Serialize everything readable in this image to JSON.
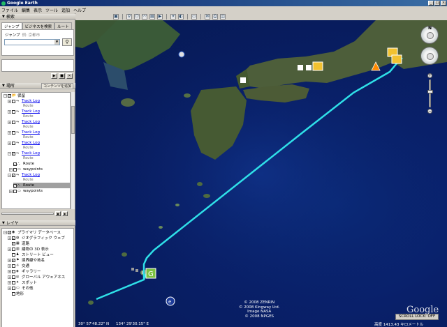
{
  "window": {
    "title": "Google Earth"
  },
  "menu": [
    "ファイル",
    "編集",
    "表示",
    "ツール",
    "追加",
    "ヘルプ"
  ],
  "search": {
    "panel_title": "検索",
    "tabs": [
      "ジャンプ",
      "ビジネスを検索",
      "ルート"
    ],
    "label": "ジャンプ",
    "placeholder": "例: 京都市",
    "value": ""
  },
  "places": {
    "panel_title": "場所",
    "add_label": "コンテンツを追加",
    "root_label": "保留",
    "items": [
      {
        "label": "Track Log",
        "sub": "Route"
      },
      {
        "label": "Track Log",
        "sub": "Route"
      },
      {
        "label": "Track Log",
        "sub": "Route"
      },
      {
        "label": "Track Log",
        "sub": "Route"
      },
      {
        "label": "Track Log",
        "sub": "Route"
      },
      {
        "label": "Track Log",
        "sub": "Route"
      }
    ],
    "expanded": [
      {
        "child": "Route",
        "waypoints": "waypoints"
      },
      {
        "parent": "Track Log",
        "sub": "Route",
        "child": "Route",
        "waypoints": "waypoints"
      }
    ]
  },
  "layers": {
    "panel_title": "レイヤ",
    "root_label": "プライマリ データベース",
    "items": [
      "ジオグラフィック ウェブ",
      "道路",
      "建物の 3D 表示",
      "ストリート ビュー",
      "境界線や地名",
      "交通",
      "ギャラリー",
      "グローバル アウェアネス",
      "スポット",
      "その他",
      "地形"
    ]
  },
  "map": {
    "credits": [
      "© 2008 ZENRIN",
      "© 2008 Kingway Ltd.",
      "Image NASA",
      "© 2008 NPGES"
    ],
    "status": {
      "lat": "30° 57'48.22\" N",
      "lon": "134° 29'30.15\" E",
      "alt": "高度 1413.43 キロメートル"
    },
    "logo": "Google",
    "scroll_lock": "SCROLL LOCK: OFF",
    "compass_label": "N"
  }
}
